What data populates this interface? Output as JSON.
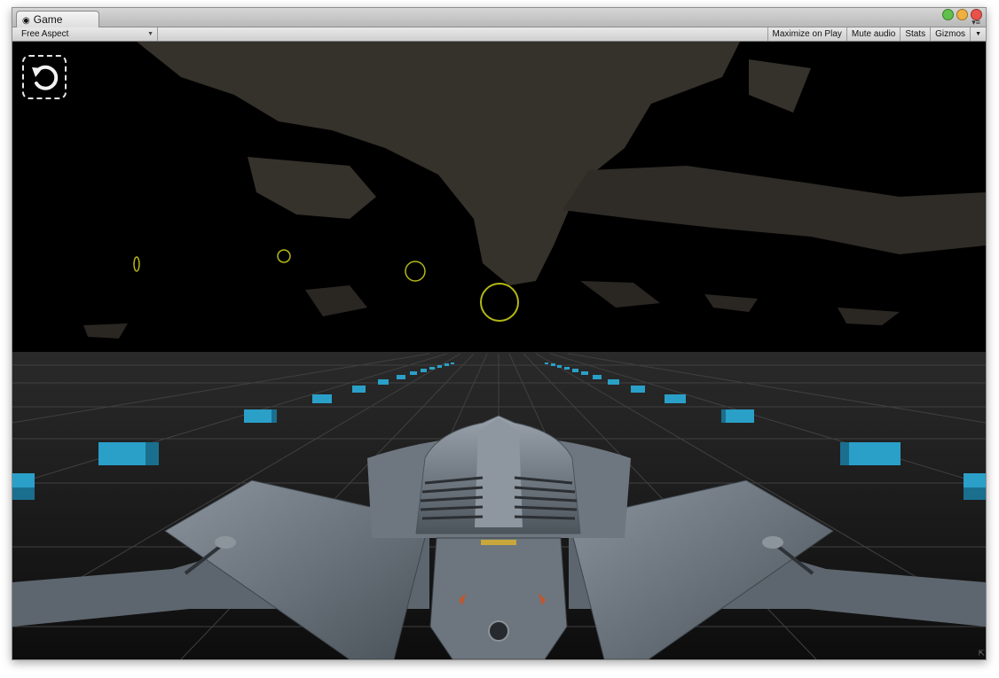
{
  "window": {
    "tab_title": "Game",
    "tab_icon": "unity-game-icon"
  },
  "toolbar": {
    "aspect_label": "Free Aspect",
    "buttons": [
      "Maximize on Play",
      "Mute audio",
      "Stats",
      "Gizmos"
    ],
    "dropdown_icon": "chevron-down-icon"
  },
  "colors": {
    "sky": "#000000",
    "cloud": "#3a3630",
    "ground": "#151515",
    "grid": "#3d3d3d",
    "marker_blue": "#2aa0c8",
    "ring": "#b4b814",
    "ship_body": "#7b8590"
  },
  "game": {
    "restart_icon": "restart-arrow-icon",
    "rings_visible": 4,
    "track_markers": "cyan blocks along both sides of the runway"
  }
}
